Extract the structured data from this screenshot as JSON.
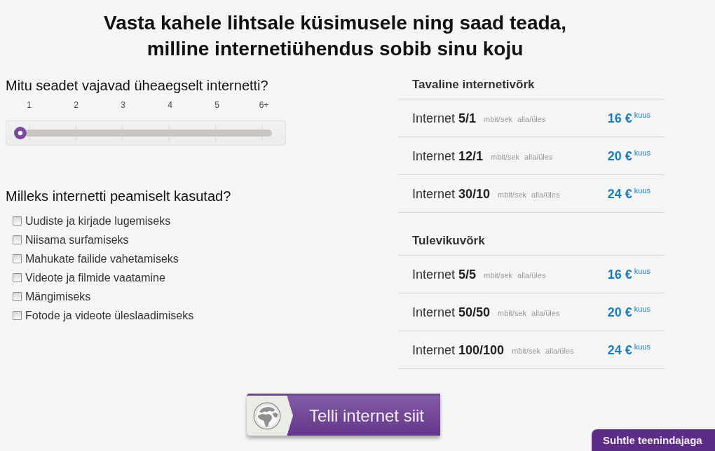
{
  "title": [
    "Vasta kahele lihtsale küsimusele ning saad teada,",
    "milline internetiühendus sobib sinu koju"
  ],
  "devices": {
    "question": "Mitu seadet vajavad üheaegselt internetti?",
    "slider": {
      "ticks": [
        "1",
        "2",
        "3",
        "4",
        "5",
        "6+"
      ],
      "level": 0
    }
  },
  "usage": {
    "question": "Milleks internetti peamiselt kasutad?",
    "options": [
      {
        "label": "Uudiste ja kirjade lugemiseks",
        "checked": false
      },
      {
        "label": "Niisama surfamiseks",
        "checked": false
      },
      {
        "label": "Mahukate failide vahetamiseks",
        "checked": false
      },
      {
        "label": "Videote ja filmide vaatamine",
        "checked": false
      },
      {
        "label": "Mängimiseks",
        "checked": false
      },
      {
        "label": "Fotode ja videote üleslaadimiseks",
        "checked": false
      }
    ]
  },
  "networks": [
    {
      "title": "Tavaline internetivõrk",
      "plans": [
        {
          "name": "Internet **5/1**",
          "unit": "mbit/sek",
          "direction": "alla/üles",
          "price": "16 €",
          "period": "kuus"
        },
        {
          "name": "Internet **12/1**",
          "unit": "mbit/sek",
          "direction": "alla/üles",
          "price": "20 €",
          "period": "kuus"
        },
        {
          "name": "Internet **30/10**",
          "unit": "mbit/sek",
          "direction": "alla/üles",
          "price": "24 €",
          "period": "kuus"
        }
      ]
    },
    {
      "title": "Tulevikuvõrk",
      "plans": [
        {
          "name": "Internet **5/5**",
          "unit": "mbit/sek",
          "direction": "alla/üles",
          "price": "16 €",
          "period": "kuus"
        },
        {
          "name": "Internet **50/50**",
          "unit": "mbit/sek",
          "direction": "alla/üles",
          "price": "20 €",
          "period": "kuus"
        },
        {
          "name": "Internet **100/100**",
          "unit": "mbit/sek",
          "direction": "alla/üles",
          "price": "24 €",
          "period": "kuus"
        }
      ]
    }
  ],
  "order_button": {
    "label": "Telli internet siit"
  },
  "chat_tab": {
    "label": "Suhtle teenindajaga"
  }
}
